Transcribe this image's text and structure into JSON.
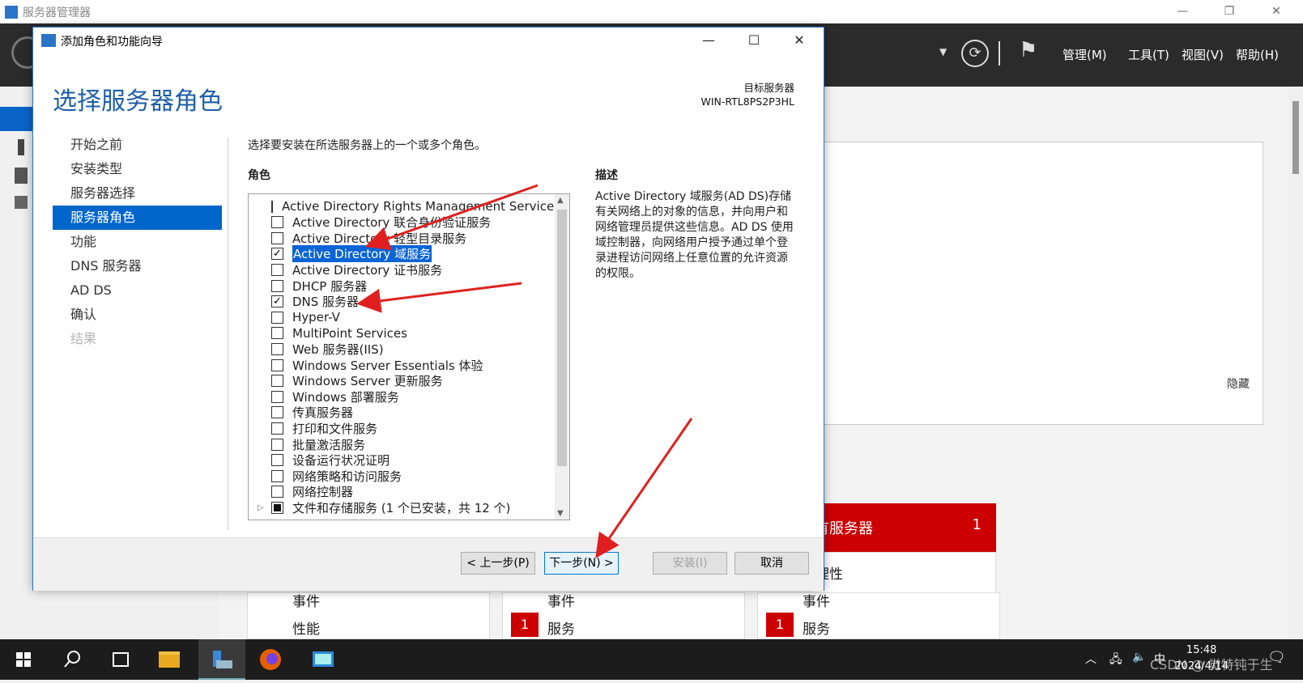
{
  "server_manager": {
    "title": "服务器管理器",
    "menus": [
      "管理(M)",
      "工具(T)",
      "视图(V)",
      "帮助(H)"
    ],
    "hide_link": "隐藏",
    "tile": {
      "title": "有服务器",
      "count": "1",
      "sub": "理性"
    },
    "bg_tiles": [
      {
        "a": "事件",
        "b": "性能",
        "badge": ""
      },
      {
        "a": "事件",
        "b": "服务",
        "badge": "1"
      },
      {
        "a": "事件",
        "b": "服务",
        "badge": "1"
      }
    ]
  },
  "wizard": {
    "title": "添加角色和功能向导",
    "heading": "选择服务器角色",
    "target_label": "目标服务器",
    "target_server": "WIN-RTL8PS2P3HL",
    "steps": [
      {
        "label": "开始之前",
        "state": "normal"
      },
      {
        "label": "安装类型",
        "state": "normal"
      },
      {
        "label": "服务器选择",
        "state": "normal"
      },
      {
        "label": "服务器角色",
        "state": "active"
      },
      {
        "label": "功能",
        "state": "normal"
      },
      {
        "label": "DNS 服务器",
        "state": "normal"
      },
      {
        "label": "AD DS",
        "state": "normal"
      },
      {
        "label": "确认",
        "state": "normal"
      },
      {
        "label": "结果",
        "state": "disabled"
      }
    ],
    "instruction": "选择要安装在所选服务器上的一个或多个角色。",
    "roles_header": "角色",
    "roles": [
      {
        "label": "Active Directory Rights Management Services",
        "checked": false
      },
      {
        "label": "Active Directory 联合身份验证服务",
        "checked": false
      },
      {
        "label": "Active Directory 轻型目录服务",
        "checked": false
      },
      {
        "label": "Active Directory 域服务",
        "checked": true,
        "selected": true
      },
      {
        "label": "Active Directory 证书服务",
        "checked": false
      },
      {
        "label": "DHCP 服务器",
        "checked": false
      },
      {
        "label": "DNS 服务器",
        "checked": true
      },
      {
        "label": "Hyper-V",
        "checked": false
      },
      {
        "label": "MultiPoint Services",
        "checked": false
      },
      {
        "label": "Web 服务器(IIS)",
        "checked": false
      },
      {
        "label": "Windows Server Essentials 体验",
        "checked": false
      },
      {
        "label": "Windows Server 更新服务",
        "checked": false
      },
      {
        "label": "Windows 部署服务",
        "checked": false
      },
      {
        "label": "传真服务器",
        "checked": false
      },
      {
        "label": "打印和文件服务",
        "checked": false
      },
      {
        "label": "批量激活服务",
        "checked": false
      },
      {
        "label": "设备运行状况证明",
        "checked": false
      },
      {
        "label": "网络策略和访问服务",
        "checked": false
      },
      {
        "label": "网络控制器",
        "checked": false
      },
      {
        "label": "文件和存储服务 (1 个已安装，共 12 个)",
        "checked": "partial",
        "expandable": true
      }
    ],
    "description_header": "描述",
    "description": "Active Directory 域服务(AD DS)存储有关网络上的对象的信息，并向用户和网络管理员提供这些信息。AD DS 使用域控制器，向网络用户授予通过单个登录进程访问网络上任意位置的允许资源的权限。",
    "buttons": {
      "prev": "< 上一步(P)",
      "next": "下一步(N) >",
      "install": "安装(I)",
      "cancel": "取消"
    }
  },
  "taskbar": {
    "time": "15:48",
    "date": "2024/4/14",
    "watermark": "CSDN @ 觉特钝于生"
  },
  "colors": {
    "accent": "#0066cc",
    "heading": "#1e5fa8",
    "alert": "#cc0000",
    "arrow": "#e02020"
  }
}
